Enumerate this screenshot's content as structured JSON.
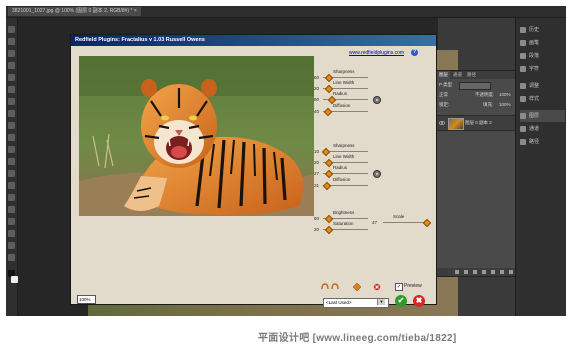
{
  "document_tab": {
    "title": "3821001_1027.jpg @ 100% (图层 0 副本 2, RGB/8#) *",
    "close_glyph": "×"
  },
  "plugin": {
    "title": "Redfield Plugins: Fractalius v 1.03   Russell Owens",
    "link": "www.redfieldplugins.com",
    "help_glyph": "?",
    "groups": [
      {
        "sliders": [
          {
            "label": "Sharpness",
            "value": "60",
            "fraction": 0.1
          },
          {
            "label": "Line Width",
            "value": "20",
            "fraction": 0.12
          },
          {
            "label": "Radius",
            "value": "80",
            "fraction": 0.18
          },
          {
            "label": "Diffusion",
            "value": "40",
            "fraction": 0.08
          }
        ]
      },
      {
        "sliders": [
          {
            "label": "Sharpness",
            "value": "10",
            "fraction": 0.05
          },
          {
            "label": "Line Width",
            "value": "20",
            "fraction": 0.12
          },
          {
            "label": "Radius",
            "value": "27",
            "fraction": 0.1
          },
          {
            "label": "Diffusion",
            "value": "21",
            "fraction": 0.06
          }
        ]
      },
      {
        "sliders": [
          {
            "label": "Brightness",
            "value": "60",
            "fraction": 0.1
          },
          {
            "label": "Saturation",
            "value": "20",
            "fraction": 0.12
          }
        ]
      }
    ],
    "scale": {
      "label": "Scale",
      "value": "47",
      "fraction": 0.95
    },
    "preview_label": "Preview",
    "preview_checked": "✓",
    "preset": "<Last Used>",
    "preset_arrow": "▼",
    "ok_glyph": "✔",
    "cancel_glyph": "✖",
    "zoom": "100%"
  },
  "right_panel": {
    "buttons": [
      "历史",
      "画笔",
      "段落",
      "字符",
      "调整",
      "样式",
      "图层",
      "通道",
      "路径"
    ]
  },
  "layers_panel": {
    "tabs": [
      "图层",
      "通道",
      "路径"
    ],
    "kind_label": "P 类型",
    "mode": "正常",
    "opacity_label": "不透明度:",
    "opacity": "100%",
    "lock_label": "锁定:",
    "fill_label": "填充:",
    "fill": "100%",
    "layer_name": "图层 0 副本 2"
  },
  "watermark": "平面设计吧 [www.lineeg.com/tieba/1822]"
}
